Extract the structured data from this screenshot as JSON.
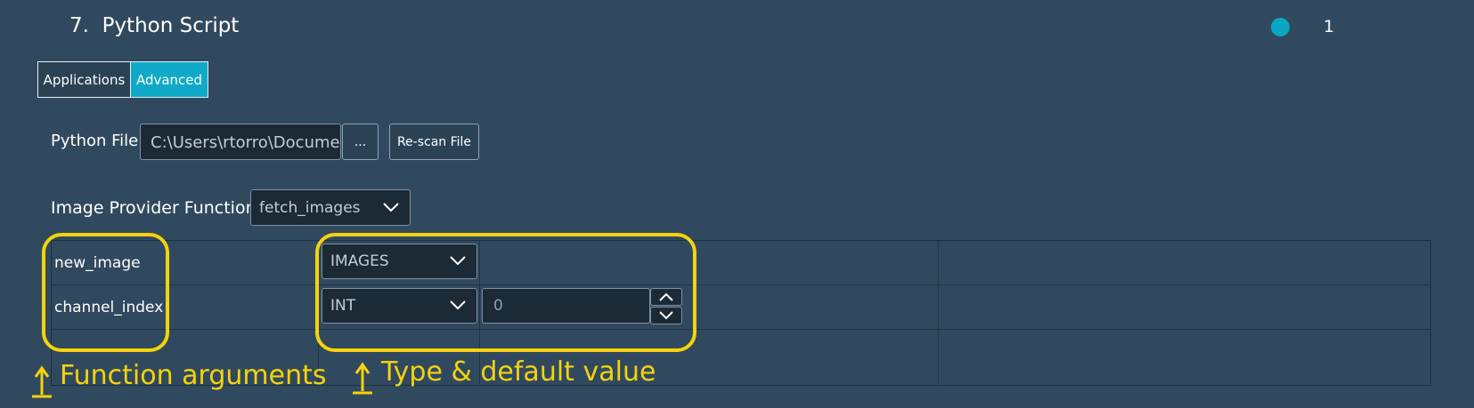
{
  "header": {
    "step_number": "7.",
    "title": "Python Script",
    "status_count": "1",
    "status_color": "#0aa6c4"
  },
  "tabs": [
    {
      "label": "Applications",
      "active": false
    },
    {
      "label": "Advanced",
      "active": true
    }
  ],
  "python_file": {
    "label": "Python File",
    "value": "C:\\Users\\rtorro\\Documen",
    "browse_label": "...",
    "rescan_label": "Re-scan File"
  },
  "image_provider": {
    "label": "Image Provider Function",
    "selected": "fetch_images"
  },
  "arguments": [
    {
      "name": "new_image",
      "type": "IMAGES"
    },
    {
      "name": "channel_index",
      "type": "INT",
      "default": "0"
    }
  ],
  "annotations": {
    "left": "Function arguments",
    "right": "Type & default value",
    "color": "#f5d30c"
  },
  "colors": {
    "background": "#31495e",
    "accent": "#10a9c8",
    "input_bg": "#1c2a36"
  }
}
